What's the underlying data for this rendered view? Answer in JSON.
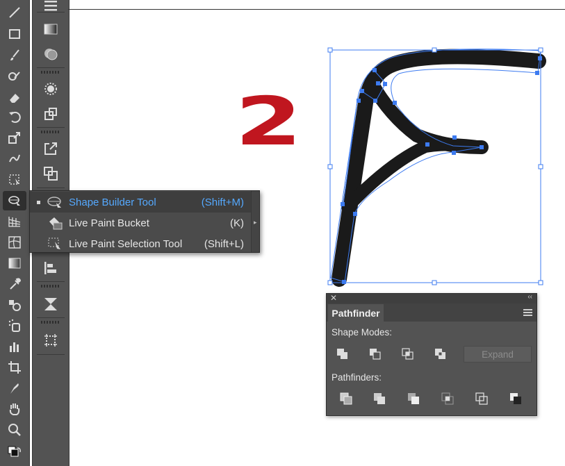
{
  "toolbar": {
    "tools": [
      "line-segment-icon",
      "rectangle-icon",
      "paintbrush-icon",
      "blob-brush-icon",
      "eraser-icon",
      "rotate-icon",
      "scale-icon",
      "warp-icon",
      "free-transform-icon",
      "shape-builder-icon",
      "perspective-grid-icon",
      "mesh-icon",
      "gradient-icon",
      "eyedropper-icon",
      "blend-icon",
      "symbol-sprayer-icon",
      "column-graph-icon",
      "artboard-icon",
      "slice-icon",
      "hand-icon",
      "zoom-icon",
      "fill-stroke-icon"
    ]
  },
  "panel_strip": {
    "buttons": [
      "menu-icon",
      "gradient-panel-icon",
      "color-guide-icon",
      "appearance-icon",
      "symbols-icon",
      "export-icon",
      "transform-icon",
      "align-icon",
      "transparency-icon",
      "artboards-icon"
    ]
  },
  "flyout": {
    "items": [
      {
        "label": "Shape Builder Tool",
        "shortcut": "(Shift+M)",
        "selected": true
      },
      {
        "label": "Live Paint Bucket",
        "shortcut": "(K)",
        "selected": false
      },
      {
        "label": "Live Paint Selection Tool",
        "shortcut": "(Shift+L)",
        "selected": false
      }
    ]
  },
  "canvas": {
    "step_number": "2",
    "step_color": "#c0161f",
    "selection_color": "#3d7bf0"
  },
  "pathfinder": {
    "title": "Pathfinder",
    "shape_modes_label": "Shape Modes:",
    "pathfinders_label": "Pathfinders:",
    "expand_label": "Expand",
    "shape_modes": [
      "unite-icon",
      "minus-front-icon",
      "intersect-icon",
      "exclude-icon"
    ],
    "pathfinder_ops": [
      "divide-icon",
      "trim-icon",
      "merge-icon",
      "crop-icon",
      "outline-icon",
      "minus-back-icon"
    ]
  },
  "colors": {
    "toolbar_bg": "#535353",
    "flyout_bg": "#4b4b4b",
    "highlight_text": "#55a9ff"
  }
}
